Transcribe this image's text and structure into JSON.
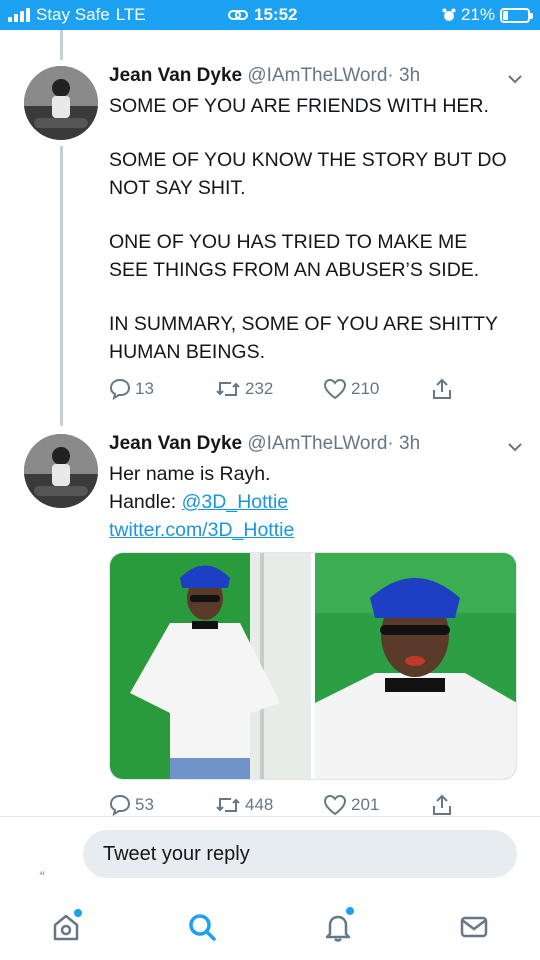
{
  "status_bar": {
    "carrier": "Stay Safe",
    "network": "LTE",
    "time": "15:52",
    "battery": "21%",
    "battery_level": 0.21,
    "bg_color": "#1da1f2"
  },
  "tweets": [
    {
      "name": "Jean Van Dyke",
      "handle": "@IAmTheLWord",
      "time": "· 3h",
      "paragraphs": [
        "SOME OF YOU ARE FRIENDS WITH HER.",
        "SOME OF YOU KNOW THE STORY BUT DO NOT SAY SHIT.",
        "ONE OF YOU HAS TRIED TO MAKE ME SEE THINGS FROM AN ABUSER’S SIDE.",
        "IN SUMMARY, SOME OF YOU ARE SHITTY HUMAN BEINGS."
      ],
      "replies": "13",
      "retweets": "232",
      "likes": "210"
    },
    {
      "name": "Jean Van Dyke",
      "handle": "@IAmTheLWord",
      "time": "· 3h",
      "line1": "Her name is Rayh.",
      "line2_prefix": "Handle: ",
      "line2_link": "@3D_Hottie",
      "line3_link": "twitter.com/3D_Hottie",
      "replies": "53",
      "retweets": "448",
      "likes": "201"
    }
  ],
  "reply_bar": {
    "placeholder": "Tweet your reply",
    "quote_mark": "“"
  },
  "tab_bar": {
    "items": [
      "home-icon",
      "search-icon",
      "notifications-icon",
      "messages-icon"
    ],
    "accent": "#1da1f2"
  },
  "colors": {
    "link": "#1b95e0",
    "secondary": "#657786"
  }
}
